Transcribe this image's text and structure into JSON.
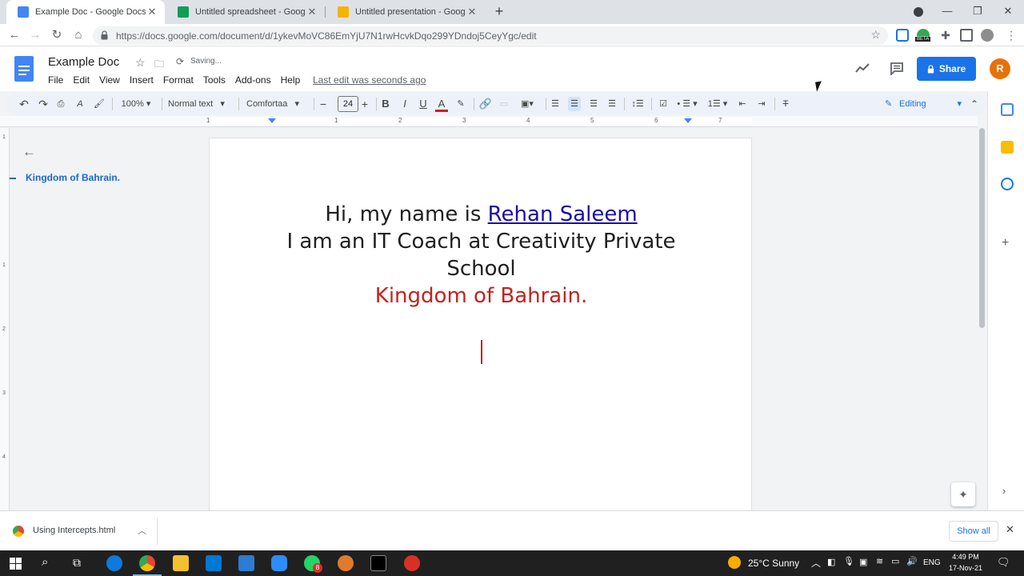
{
  "browser": {
    "tabs": [
      {
        "title": "Example Doc - Google Docs",
        "color": "#4285f4",
        "active": true
      },
      {
        "title": "Untitled spreadsheet - Google Sh",
        "color": "#0f9d58",
        "active": false
      },
      {
        "title": "Untitled presentation - Google Sl",
        "color": "#f4b400",
        "active": false
      }
    ],
    "url": "https://docs.google.com/document/d/1ykevMoVC86EmYjU7N1rwHcvkDqo299YDndoj5CeyYgc/edit",
    "extension_badge": "BETA"
  },
  "docs": {
    "title": "Example Doc",
    "save_status": "Saving...",
    "menu": [
      "File",
      "Edit",
      "View",
      "Insert",
      "Format",
      "Tools",
      "Add-ons",
      "Help"
    ],
    "last_edit": "Last edit was seconds ago",
    "share_label": "Share",
    "avatar_letter": "R",
    "toolbar": {
      "zoom": "100%",
      "style": "Normal text",
      "font": "Comfortaa",
      "font_size": "24",
      "mode": "Editing"
    },
    "ruler_numbers": [
      "1",
      "1",
      "2",
      "3",
      "4",
      "5",
      "6",
      "7"
    ],
    "vruler_numbers": [
      "1",
      "1",
      "2",
      "3",
      "4"
    ],
    "outline": {
      "item": "Kingdom of Bahrain."
    },
    "content": {
      "line1_prefix": "Hi, my name is ",
      "line1_link": "Rehan Saleem",
      "line2": "I am an IT Coach at Creativity Private",
      "line3": "School",
      "line4": "Kingdom of Bahrain."
    }
  },
  "download_shelf": {
    "file": "Using Intercepts.html",
    "show_all": "Show all"
  },
  "taskbar": {
    "weather": "25°C  Sunny",
    "lang": "ENG",
    "time": "4:49 PM",
    "date": "17-Nov-21",
    "whatsapp_badge": "8"
  }
}
